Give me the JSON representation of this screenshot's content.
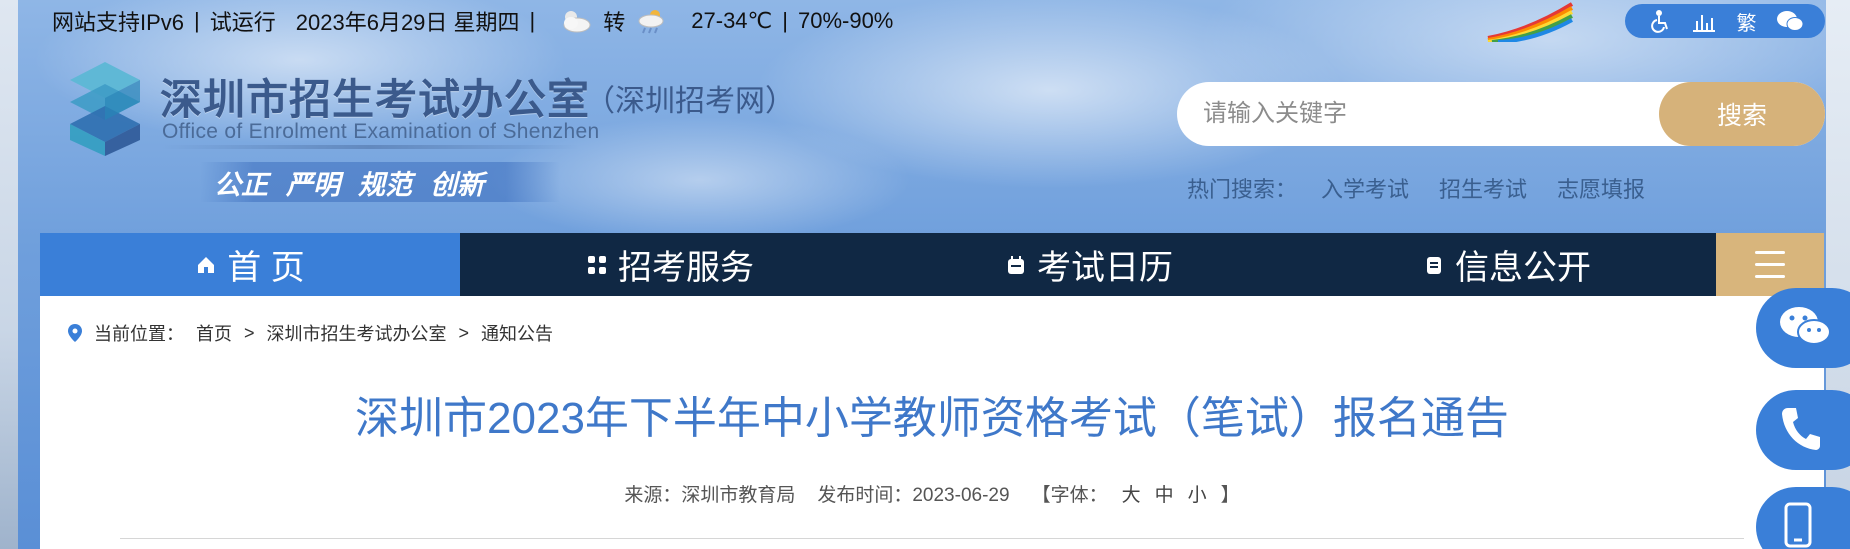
{
  "topbar": {
    "ipv6": "网站支持IPv6",
    "trial": "试运行",
    "date": "2023年6月29日 星期四",
    "weather_transition": "转",
    "temperature": "27-34℃",
    "humidity": "70%-90%",
    "sep": "|"
  },
  "accessibility": {
    "traditional": "繁"
  },
  "logo": {
    "title": "深圳市招生考试办公室",
    "subtitle": "（深圳招考网）",
    "english": "Office of Enrolment Examination of Shenzhen",
    "motto": [
      "公正",
      "严明",
      "规范",
      "创新"
    ]
  },
  "search": {
    "placeholder": "请输入关键字",
    "button": "搜索",
    "hot_label": "热门搜索：",
    "hot_terms": [
      "入学考试",
      "招生考试",
      "志愿填报"
    ]
  },
  "nav": {
    "items": [
      {
        "label": "首 页",
        "active": true
      },
      {
        "label": "招考服务",
        "active": false
      },
      {
        "label": "考试日历",
        "active": false
      },
      {
        "label": "信息公开",
        "active": false
      }
    ]
  },
  "breadcrumb": {
    "label": "当前位置：",
    "items": [
      "首页",
      "深圳市招生考试办公室",
      "通知公告"
    ],
    "separator": ">"
  },
  "article": {
    "title": "深圳市2023年下半年中小学教师资格考试（笔试）报名通告",
    "source": "来源：深圳市教育局",
    "published": "发布时间：2023-06-29",
    "font_label_open": "【字体：",
    "font_sizes": [
      "大",
      "中",
      "小"
    ],
    "font_label_close": "】"
  },
  "colors": {
    "nav_dark": "#102844",
    "accent_blue": "#3a7fd8",
    "gold": "#d6b27a",
    "title_blue": "#3f78c9"
  }
}
